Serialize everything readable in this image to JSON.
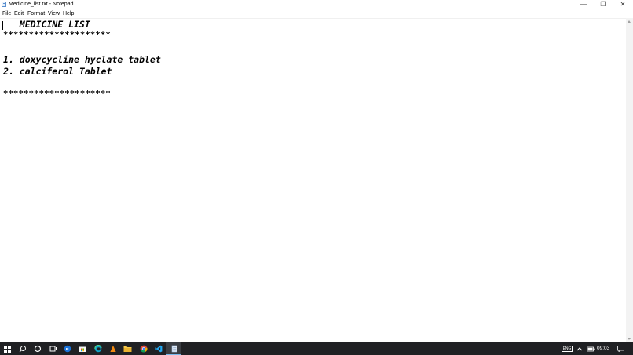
{
  "window": {
    "title": "Medicine_list.txt - Notepad"
  },
  "controls": {
    "minimize": "—",
    "maximize": "❐",
    "close": "✕"
  },
  "menu": {
    "file": "File",
    "edit": "Edit",
    "format": "Format",
    "view": "View",
    "help": "Help"
  },
  "document": {
    "heading": "   MEDICINE LIST",
    "top_rule": "*********************",
    "items": [
      "1. doxycycline hyclate tablet",
      "2. calciferol Tablet"
    ],
    "bottom_rule": "*********************"
  },
  "taskbar": {
    "apps": [
      "start-icon",
      "search-icon",
      "cortana-icon",
      "task-view-icon",
      "app-blue-icon",
      "store-icon",
      "edge-icon",
      "vlc-icon",
      "file-explorer-icon",
      "chrome-icon",
      "vscode-icon",
      "notepad-icon"
    ],
    "keyboard_label": "ENG",
    "clock": "09:03"
  },
  "colors": {
    "taskbar": "#202124",
    "accent": "#76b9ed"
  }
}
